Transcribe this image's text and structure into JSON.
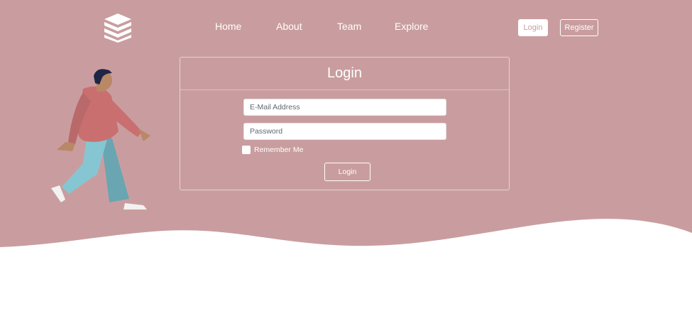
{
  "colors": {
    "hero_bg": "#c99d9f",
    "accent_text": "#c99d9f",
    "white": "#ffffff"
  },
  "header": {
    "logo_icon": "stacked-layers-icon",
    "nav": [
      {
        "label": "Home"
      },
      {
        "label": "About"
      },
      {
        "label": "Team"
      },
      {
        "label": "Explore"
      }
    ],
    "login_label": "Login",
    "register_label": "Register"
  },
  "login_form": {
    "title": "Login",
    "email_placeholder": "E-Mail Address",
    "password_placeholder": "Password",
    "remember_label": "Remember Me",
    "submit_label": "Login"
  },
  "illustration": {
    "icon": "walking-person-illustration"
  }
}
